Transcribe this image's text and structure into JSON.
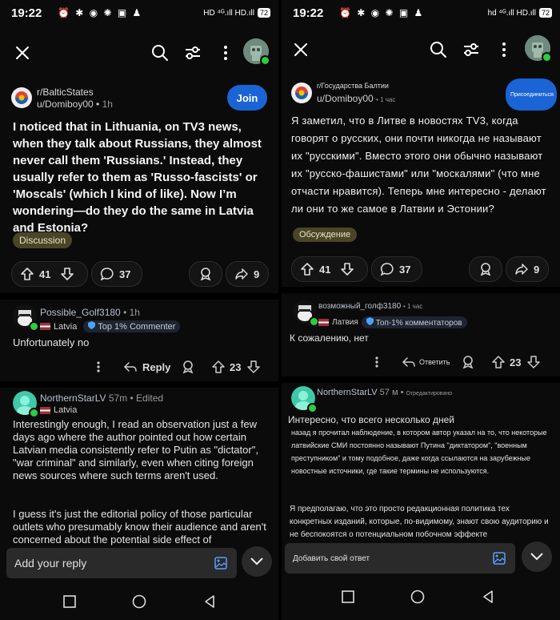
{
  "left": {
    "status": {
      "time": "19:22",
      "icons": "⏰ ✱ ◉ ✺ ▣ ♟",
      "right": "HD ⁴ᴳ.ıll HD.ıll",
      "battery": "72"
    },
    "post": {
      "subreddit": "r/BalticStates",
      "user": "u/Domiboy00",
      "time": "1h",
      "join_label": "Join",
      "title": "I noticed that in Lithuania, on TV3 news, when they talk about Russians, they almost never call them 'Russians.' Instead, they usually refer to them as 'Russo-fascists' or 'Moscals' (which I kind of like). Now I’m wondering—do they do the same in Latvia and Estonia?",
      "flair": "Discussion",
      "upvotes": "41",
      "comments": "37",
      "shares": "9"
    },
    "comment1": {
      "user": "Possible_Golf3180",
      "time": "1h",
      "flair_country": "Latvia",
      "badge": "Top 1% Commenter",
      "text": "Unfortunately no",
      "reply_label": "Reply",
      "votes": "23"
    },
    "comment2": {
      "user": "NorthernStarLV",
      "time": "57m",
      "edited": "Edited",
      "flair_country": "Latvia",
      "p1": "Interestingly enough, I read an observation just a few days ago where the author pointed out how certain Latvian media consistently refer to Putin as \"dictator\", \"war criminal\" and similarly, even when citing foreign news sources where such terms aren't used.",
      "p2": "I guess it's just the editorial policy of those particular outlets who presumably know their audience and aren't concerned about the potential side effect of"
    },
    "reply_placeholder": "Add your reply"
  },
  "right": {
    "status": {
      "time": "19:22",
      "icons": "⏰ ✱ ◉ ✺ ▣ ♟",
      "right": "hd ⁴ᴳ.ıll HD.ıll",
      "battery": "72"
    },
    "post": {
      "subreddit": "r/Государства Балтии",
      "user": "u/Domiboy00",
      "time": "1 час",
      "join_label": "Присоединиться",
      "title": "Я заметил, что в Литве в новостях TV3, когда говорят о русских, они почти никогда не называют их \"русскими\". Вместо этого они обычно называют их \"русско-фашистами\" или \"москалями\" (что мне отчасти нравится). Теперь мне интересно - делают ли они то же самое в Латвии и Эстонии?",
      "flair": "Обсуждение",
      "upvotes": "41",
      "comments": "37",
      "shares": "9"
    },
    "comment1": {
      "user": "возможный_голф3180",
      "time": "1 час",
      "flair_country": "Латвия",
      "badge": "Топ-1% комментаторов",
      "text": "К сожалению, нет",
      "reply_label": "Ответить",
      "votes": "23"
    },
    "comment2": {
      "user": "NorthernStarLV",
      "time": "57 м",
      "edited": "Отредактировано",
      "p1a": "Интересно, что всего несколько дней",
      "p1b": "назад я прочитал наблюдение, в котором автор указал на то, что некоторые латвийские СМИ постоянно называют Путина \"диктатором\", \"военным преступником\" и тому подобное, даже когда ссылаются на зарубежные новостные источники, где такие термины не используются.",
      "p2": "Я предполагаю, что это просто редакционная политика тех конкретных изданий, которые, по-видимому, знают свою аудиторию и не беспокоятся о потенциальном побочном эффекте"
    },
    "reply_placeholder": "Добавить свой ответ"
  },
  "colors": {
    "join": "#1a64d6",
    "flair_bg": "#4b4527",
    "online": "#2ecc40",
    "background": "#0b0b0b"
  }
}
